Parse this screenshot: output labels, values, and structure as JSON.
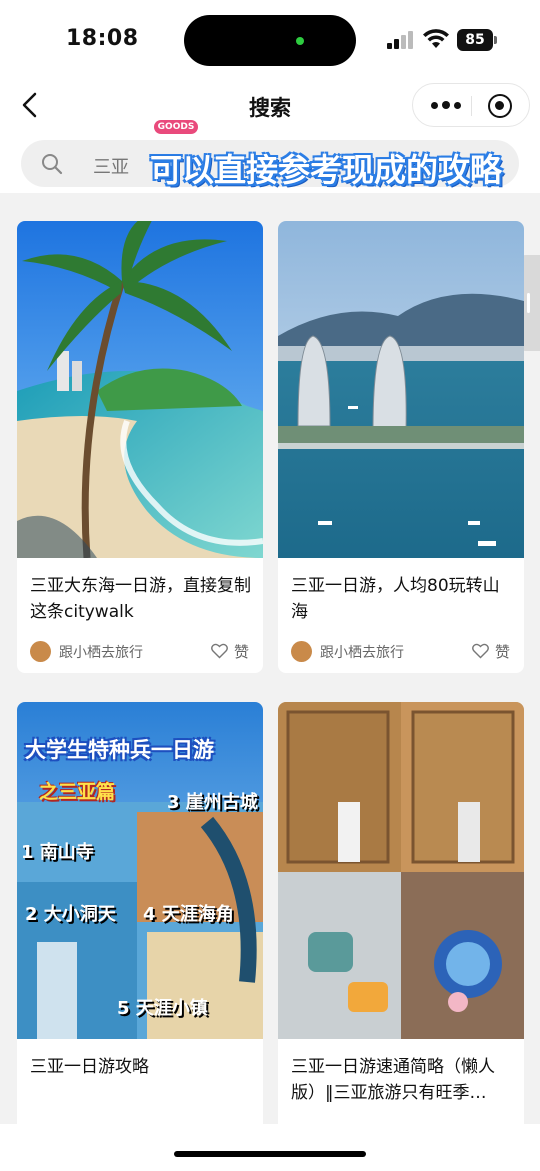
{
  "status_bar": {
    "time": "18:08",
    "battery": "85"
  },
  "nav": {
    "title": "搜索"
  },
  "search": {
    "query": "三亚"
  },
  "promo": {
    "badge": "GOODS",
    "caption": "可以直接参考现成的攻略"
  },
  "colors": {
    "promo_blue": "#2e80e8",
    "badge_pink": "#e94a7c"
  },
  "cards": [
    {
      "title": "三亚大东海一日游，直接复制这条citywalk",
      "author": "跟小栖去旅行",
      "like_label": "赞",
      "image": "beach-palm-photo"
    },
    {
      "title": "三亚一日游，人均80玩转山海",
      "author": "跟小栖去旅行",
      "like_label": "赞",
      "image": "phoenix-island-photo"
    },
    {
      "title": "三亚一日游攻略",
      "author": "",
      "like_label": "",
      "image": "sanya-itinerary-collage",
      "overlay": {
        "headline": "大学生特种兵一日游",
        "sub": "之三亚篇",
        "spots": [
          "1 南山寺",
          "2 大小洞天",
          "3 崖州古城",
          "4 天涯海角",
          "5 天涯小镇"
        ]
      }
    },
    {
      "title": "三亚一日游速通简略（懒人版）‖三亚旅游只有旺季…",
      "author": "",
      "like_label": "",
      "image": "street-scooter-collage"
    }
  ]
}
